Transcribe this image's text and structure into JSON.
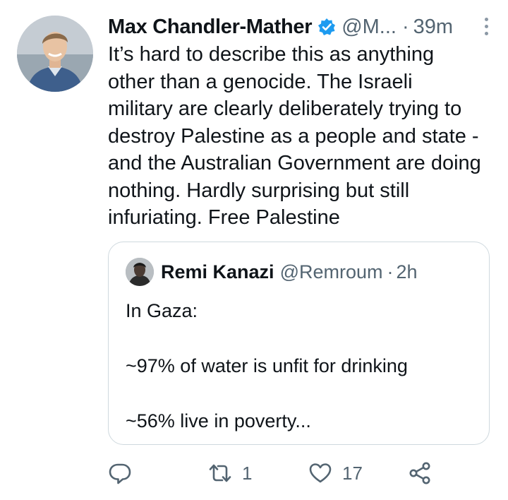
{
  "tweet": {
    "author_name": "Max Chandler-Mather",
    "author_handle": "@M...",
    "separator": "·",
    "time": "39m",
    "text": "It’s hard to describe this as anything\nother than a genocide. The Israeli\nmilitary are clearly deliberately trying to\ndestroy Palestine as a people and state -\nand the Australian Government are doing\nnothing. Hardly surprising but still\ninfuriating. Free Palestine"
  },
  "quote": {
    "author_name": "Remi Kanazi",
    "author_handle": "@Remroum",
    "separator": "·",
    "time": "2h",
    "text": "In Gaza:\n\n~97% of water is unfit for drinking\n\n~56% live in poverty..."
  },
  "actions": {
    "reply_count": "",
    "retweet_count": "1",
    "like_count": "17"
  },
  "colors": {
    "text": "#0f1419",
    "secondary": "#536471",
    "border": "#cfd9de",
    "verified": "#1d9bf0"
  },
  "icons": [
    "verified-badge-icon",
    "more-icon",
    "reply-icon",
    "retweet-icon",
    "like-icon",
    "share-icon"
  ]
}
